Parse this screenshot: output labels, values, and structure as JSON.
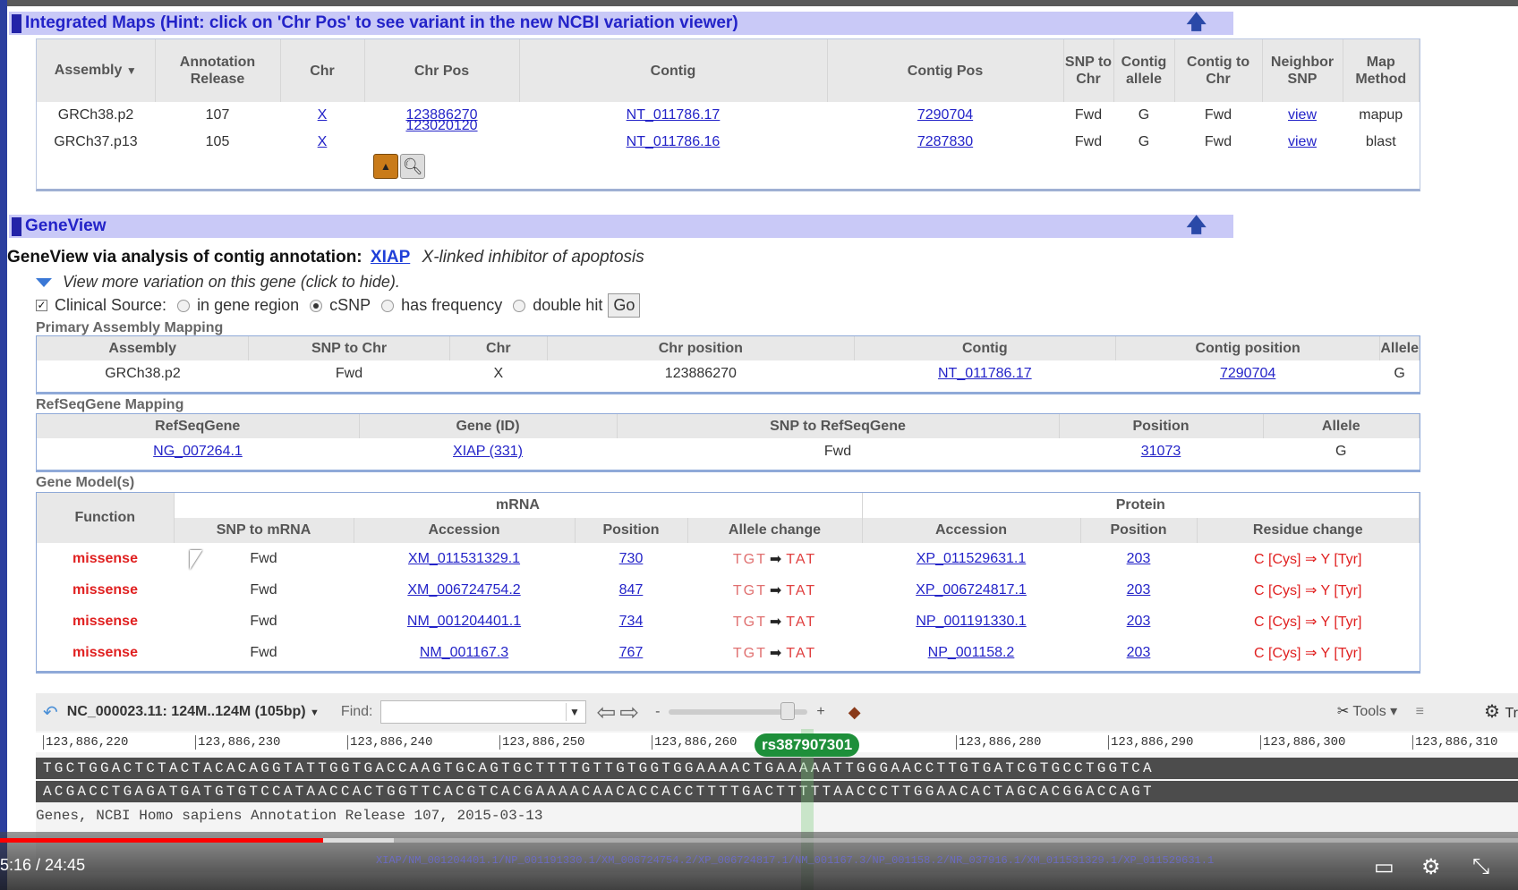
{
  "integrated_maps": {
    "title": "Integrated Maps (Hint: click on 'Chr Pos' to see variant in the new NCBI variation viewer)",
    "up_icon": "up-arrow-icon",
    "headers": {
      "assembly": "Assembly",
      "annotation_release": "Annotation Release",
      "chr": "Chr",
      "chr_pos": "Chr Pos",
      "contig": "Contig",
      "contig_pos": "Contig Pos",
      "snp_to_chr": "SNP to Chr",
      "contig_allele": "Contig allele",
      "contig_to_chr": "Contig to Chr",
      "neighbor_snp": "Neighbor SNP",
      "map_method": "Map Method"
    },
    "rows": [
      {
        "assembly": "GRCh38.p2",
        "release": "107",
        "chr": "X",
        "chr_pos": "123886270",
        "contig": "NT_011786.17",
        "contig_pos": "7290704",
        "snp_to_chr": "Fwd",
        "contig_allele": "G",
        "contig_to_chr": "Fwd",
        "neighbor": "view",
        "method": "mapup"
      },
      {
        "assembly": "GRCh37.p13",
        "release": "105",
        "chr": "X",
        "chr_pos": "123020120",
        "contig": "NT_011786.16",
        "contig_pos": "7287830",
        "snp_to_chr": "Fwd",
        "contig_allele": "G",
        "contig_to_chr": "Fwd",
        "neighbor": "view",
        "method": "blast"
      }
    ]
  },
  "geneview": {
    "title": "GeneView",
    "heading": "GeneView via analysis of contig annotation:",
    "gene": "XIAP",
    "gene_desc": "X-linked inhibitor of apoptosis",
    "more_variation": "View more variation on this gene (click to hide).",
    "clinical_source": "Clinical Source:",
    "opt_gene_region": "in gene region",
    "opt_csnp": "cSNP",
    "opt_frequency": "has frequency",
    "opt_double_hit": "double hit",
    "go": "Go"
  },
  "primary_mapping": {
    "label": "Primary Assembly Mapping",
    "headers": [
      "Assembly",
      "SNP to Chr",
      "Chr",
      "Chr position",
      "Contig",
      "Contig position",
      "Allele"
    ],
    "row": {
      "assembly": "GRCh38.p2",
      "snp_to_chr": "Fwd",
      "chr": "X",
      "chr_position": "123886270",
      "contig": "NT_011786.17",
      "contig_position": "7290704",
      "allele": "G"
    }
  },
  "refseqgene": {
    "label": "RefSeqGene Mapping",
    "headers": [
      "RefSeqGene",
      "Gene (ID)",
      "SNP to RefSeqGene",
      "Position",
      "Allele"
    ],
    "row": {
      "refseqgene": "NG_007264.1",
      "gene_id": "XIAP (331)",
      "snp_to_refseq": "Fwd",
      "position": "31073",
      "allele": "G"
    }
  },
  "gene_models": {
    "label": "Gene Model(s)",
    "group_mrna": "mRNA",
    "group_protein": "Protein",
    "headers": {
      "function": "Function",
      "snp_to_mrna": "SNP to mRNA",
      "accession": "Accession",
      "position": "Position",
      "allele_change": "Allele change",
      "p_accession": "Accession",
      "p_position": "Position",
      "residue_change": "Residue change"
    },
    "rows": [
      {
        "function": "missense",
        "snp": "Fwd",
        "mrna": "XM_011531329.1",
        "pos": "730",
        "from": "TGT",
        "to": "TAT",
        "protein": "XP_011529631.1",
        "ppos": "203",
        "residue": "C [Cys] ⇒ Y [Tyr]"
      },
      {
        "function": "missense",
        "snp": "Fwd",
        "mrna": "XM_006724754.2",
        "pos": "847",
        "from": "TGT",
        "to": "TAT",
        "protein": "XP_006724817.1",
        "ppos": "203",
        "residue": "C [Cys] ⇒ Y [Tyr]"
      },
      {
        "function": "missense",
        "snp": "Fwd",
        "mrna": "NM_001204401.1",
        "pos": "734",
        "from": "TGT",
        "to": "TAT",
        "protein": "NP_001191330.1",
        "ppos": "203",
        "residue": "C [Cys] ⇒ Y [Tyr]"
      },
      {
        "function": "missense",
        "snp": "Fwd",
        "mrna": "NM_001167.3",
        "pos": "767",
        "from": "TGT",
        "to": "TAT",
        "protein": "NP_001158.2",
        "ppos": "203",
        "residue": "C [Cys] ⇒ Y [Tyr]"
      }
    ]
  },
  "viewer": {
    "sequence_selector": "NC_000023.11: 124M..124M (105bp)",
    "find_label": "Find:",
    "zoom_minus": "-",
    "zoom_plus": "+",
    "tools": "Tools",
    "tr_label": "Tr",
    "ruler": [
      "123,886,220",
      "123,886,230",
      "123,886,240",
      "123,886,250",
      "123,886,260",
      "123,886,280",
      "123,886,290",
      "123,886,300",
      "123,886,310"
    ],
    "snp_badge": "rs387907301",
    "seq_top": "TGCTGGACTCTACTACACAGGTATTGGTGACCAAGTGCAGTGCTTTTGTTGTGGTGGAAAACTGAAAAATTGGGAACCTTGTGATCGTGCCTGGTCA",
    "seq_bottom": "ACGACCTGAGATGATGTGTCCATAACCACTGGTTCACGTCACGAAAACAACACCACCTTTTGACTTTTTAACCCTTGGAACACTAGCACGGACCAGT",
    "track": "Genes, NCBI Homo sapiens Annotation Release 107, 2015-03-13",
    "faint_track": "XIAP/NM_001204401.1/NP_001191330.1/XM_006724754.2/XP_006724817.1/NM_001167.3/NP_001158.2/NR_037916.1/XM_011531329.1/XP_011529631.1"
  },
  "video": {
    "time": "5:16 / 24:45",
    "progress": 0.2127,
    "accent": "#ff0000"
  }
}
